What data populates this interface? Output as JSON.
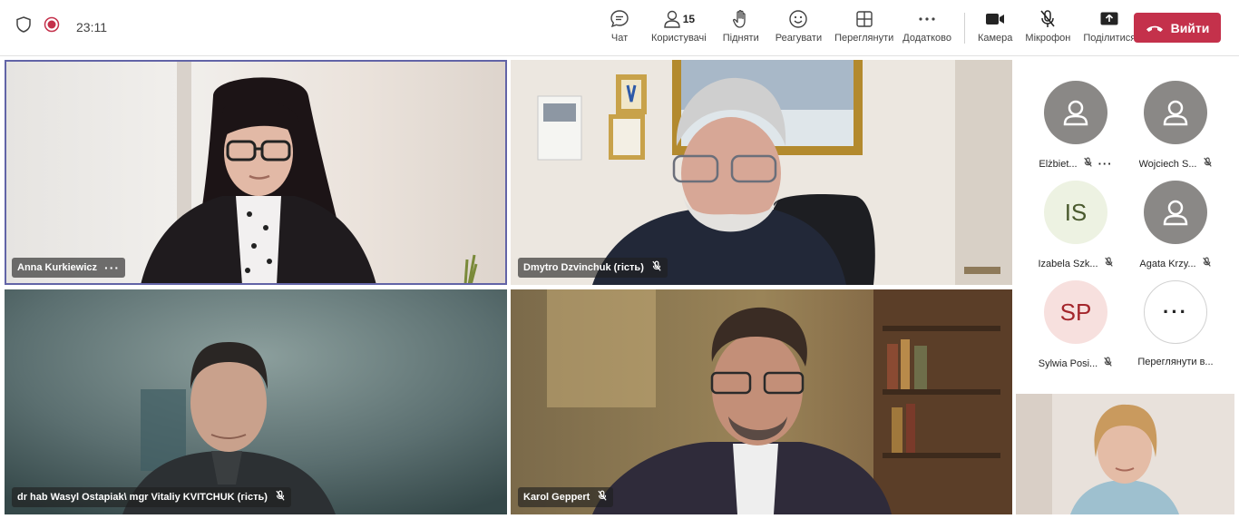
{
  "status": {
    "timer": "23:11"
  },
  "toolbar": {
    "chat": "Чат",
    "users": "Користувачі",
    "users_count": "15",
    "raise": "Підняти",
    "react": "Реагувати",
    "view": "Переглянути",
    "more": "Додатково",
    "camera": "Камера",
    "mic": "Мікрофон",
    "share": "Поділитися",
    "leave": "Вийти"
  },
  "tiles": {
    "t1": {
      "name": "Anna Kurkiewicz"
    },
    "t2": {
      "name": "Dmytro Dzvinchuk (гість)"
    },
    "t3": {
      "name": "dr hab Wasyl Ostapiak\\ mgr Vitaliy KVITCHUK (гість)"
    },
    "t4": {
      "name": "Karol Geppert"
    }
  },
  "roster": {
    "p1": {
      "name": "Elżbiet...",
      "avatar": "person-icon"
    },
    "p2": {
      "name": "Wojciech S...",
      "avatar": "person-icon"
    },
    "p3": {
      "name": "Izabela Szk...",
      "initials": "IS"
    },
    "p4": {
      "name": "Agata Krzy...",
      "avatar": "person-icon"
    },
    "p5": {
      "name": "Sylwia Posi...",
      "initials": "SP"
    },
    "p6": {
      "name": "Переглянути в...",
      "avatar": "more-icon"
    }
  },
  "colors": {
    "accent": "#6264a7",
    "leave": "#c4314b",
    "recording": "#c4314b"
  }
}
